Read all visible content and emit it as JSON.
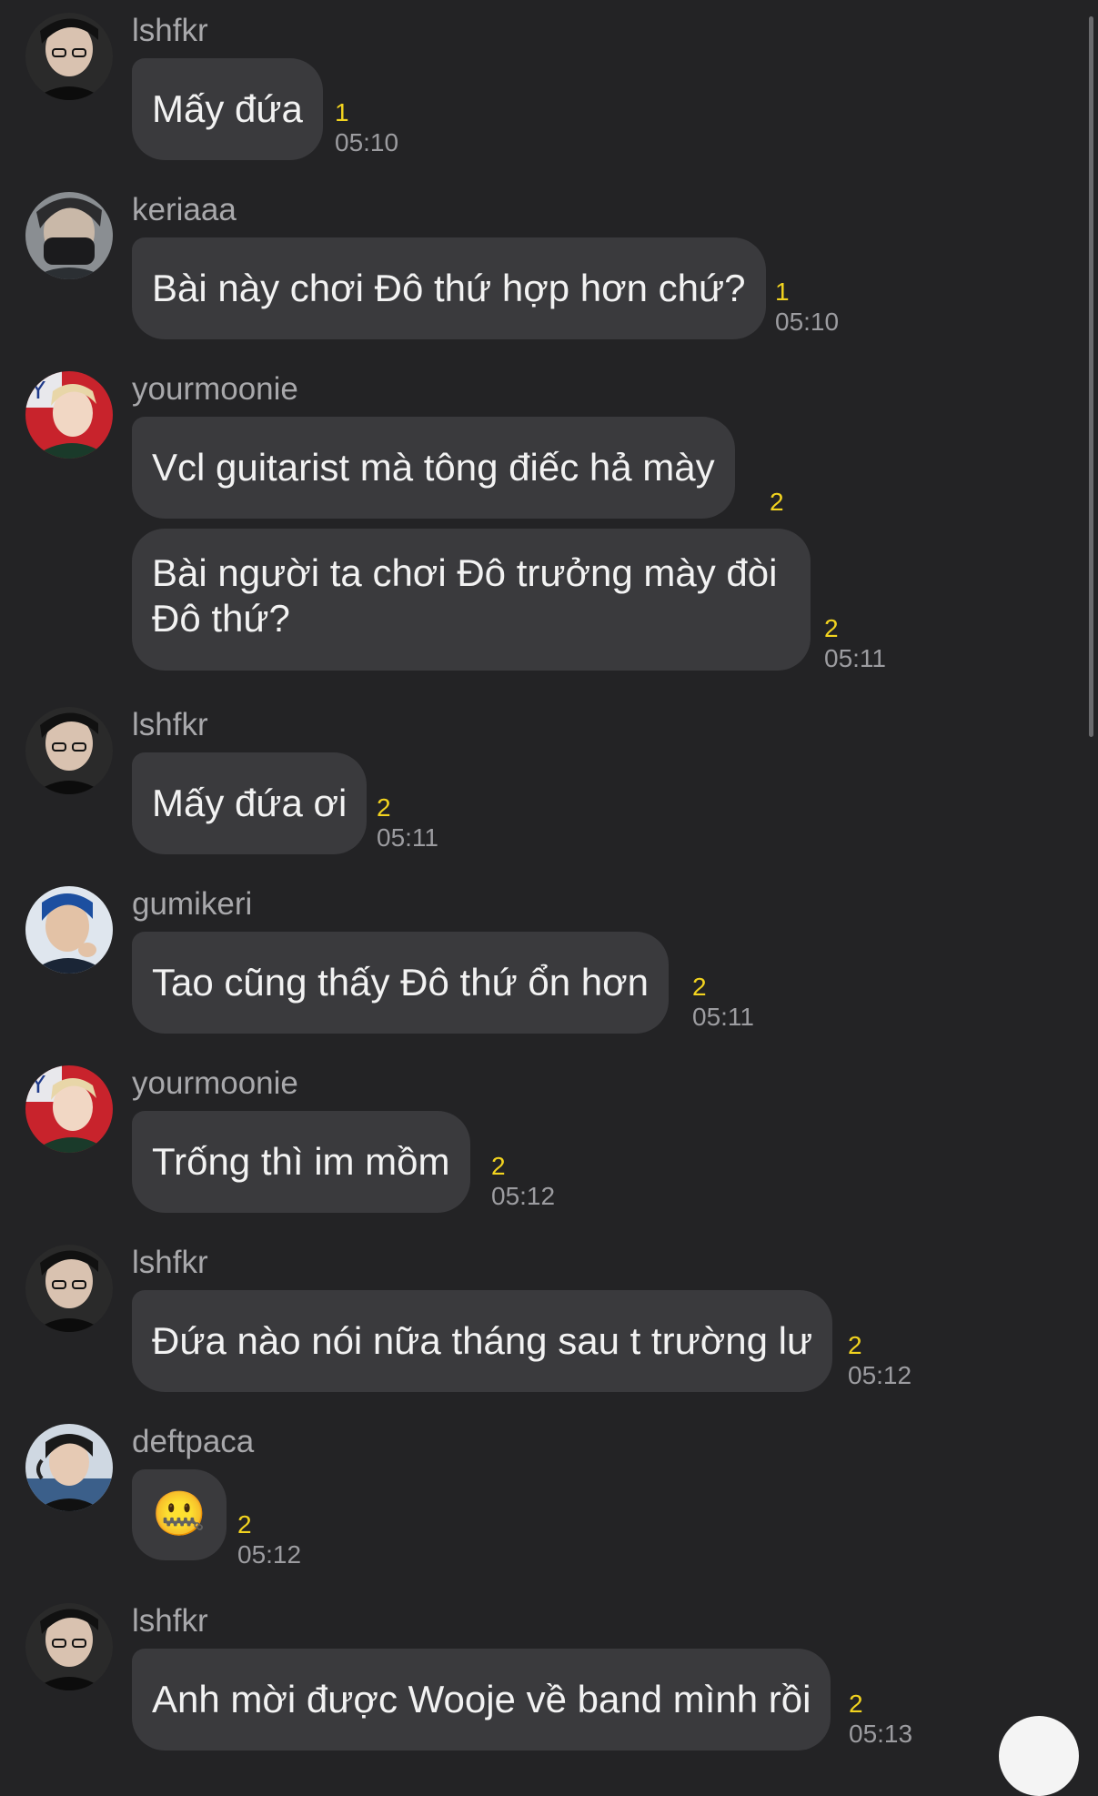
{
  "messages": [
    {
      "user": "lshfkr",
      "bubbles": [
        {
          "text": "Mấy đứa",
          "count": "1",
          "time": "05:10"
        }
      ]
    },
    {
      "user": "keriaaa",
      "bubbles": [
        {
          "text": "Bài này chơi Đô thứ hợp hơn chứ?",
          "count": "1",
          "time": "05:10"
        }
      ]
    },
    {
      "user": "yourmoonie",
      "bubbles": [
        {
          "text": "Vcl guitarist mà tông điếc hả mày",
          "count": "2",
          "time": ""
        },
        {
          "text": "Bài người ta chơi Đô trưởng mày đòi Đô thứ?",
          "count": "2",
          "time": "05:11"
        }
      ]
    },
    {
      "user": "lshfkr",
      "bubbles": [
        {
          "text": "Mấy đứa ơi",
          "count": "2",
          "time": "05:11"
        }
      ]
    },
    {
      "user": "gumikeri",
      "bubbles": [
        {
          "text": "Tao cũng thấy Đô thứ ổn hơn",
          "count": "2",
          "time": "05:11"
        }
      ]
    },
    {
      "user": "yourmoonie",
      "bubbles": [
        {
          "text": "Trống thì im mồm",
          "count": "2",
          "time": "05:12"
        }
      ]
    },
    {
      "user": "lshfkr",
      "bubbles": [
        {
          "text": "Đứa nào nói nữa tháng sau t trường lư",
          "count": "2",
          "time": "05:12"
        }
      ]
    },
    {
      "user": "deftpaca",
      "bubbles": [
        {
          "text": "🤐",
          "count": "2",
          "time": "05:12"
        }
      ]
    },
    {
      "user": "lshfkr",
      "bubbles": [
        {
          "text": "Anh mời được Wooje về band mình rồi",
          "count": "2",
          "time": "05:13"
        }
      ]
    }
  ],
  "icons": {
    "scroll_button": "scroll-to-bottom-icon"
  },
  "colors": {
    "background": "#232325",
    "bubble": "#3a3a3d",
    "unread_count": "#f2d31f",
    "username": "#a8a8ab",
    "timestamp": "#9c9ca0"
  }
}
